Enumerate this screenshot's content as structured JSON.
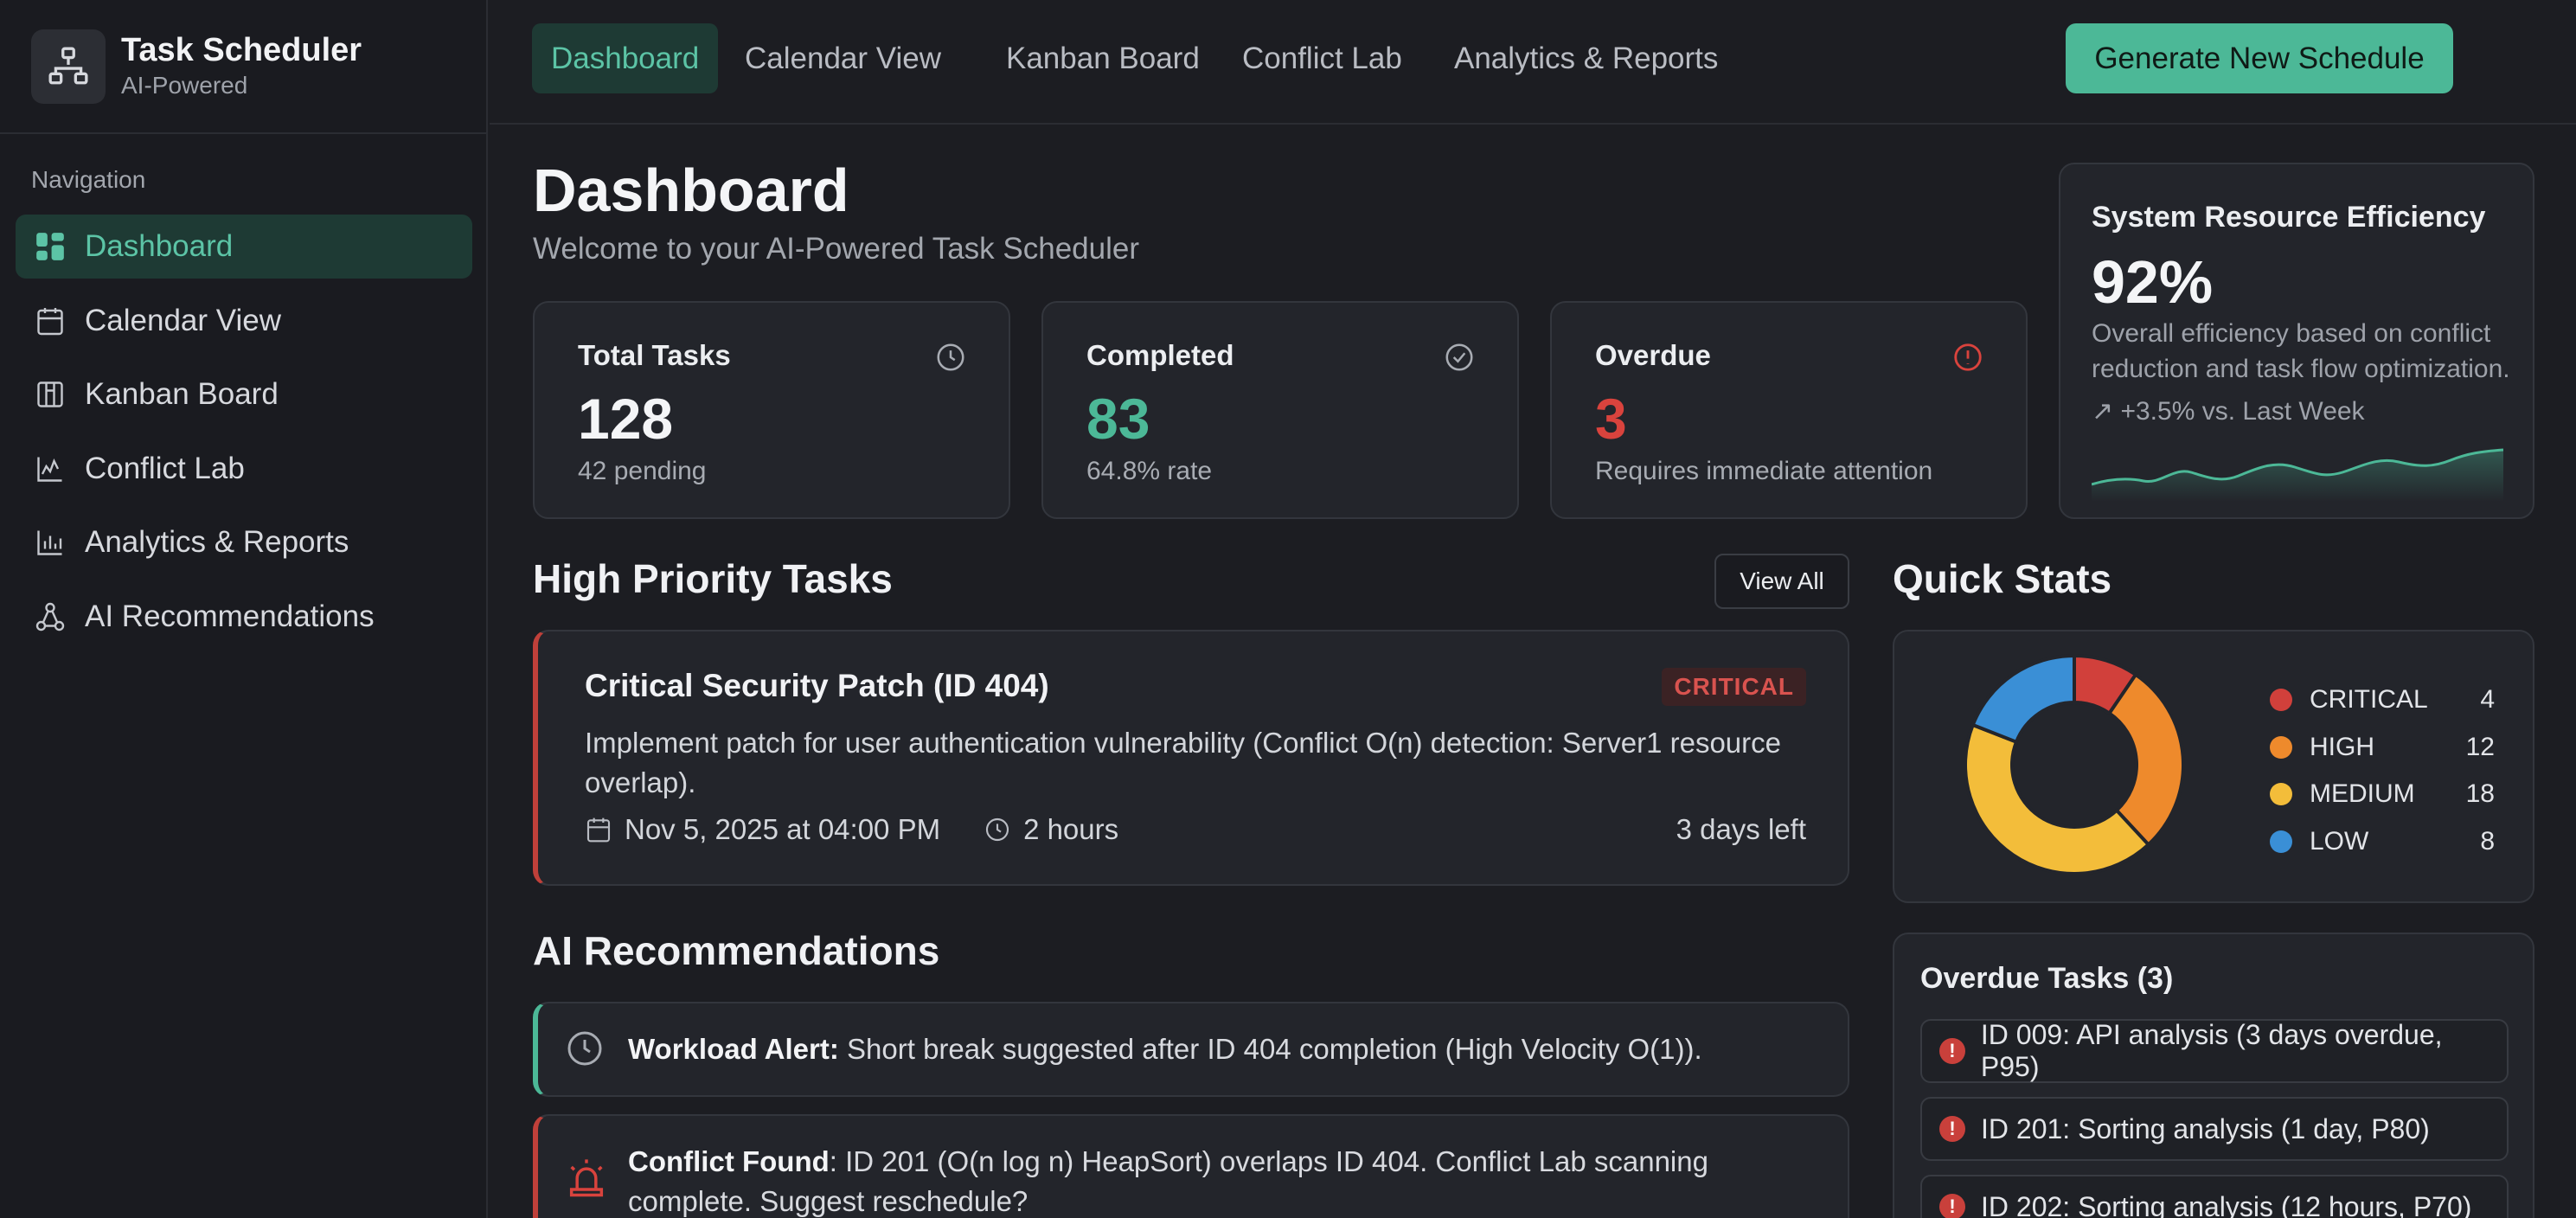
{
  "app": {
    "title": "Task Scheduler",
    "subtitle": "AI-Powered"
  },
  "sidebar": {
    "heading": "Navigation",
    "items": [
      {
        "label": "Dashboard",
        "icon": "dashboard-icon",
        "active": true
      },
      {
        "label": "Calendar View",
        "icon": "calendar-icon"
      },
      {
        "label": "Kanban Board",
        "icon": "kanban-icon"
      },
      {
        "label": "Conflict Lab",
        "icon": "conflict-lab-icon"
      },
      {
        "label": "Analytics & Reports",
        "icon": "analytics-icon"
      },
      {
        "label": "AI Recommendations",
        "icon": "ai-network-icon"
      }
    ]
  },
  "topbar": {
    "tabs": [
      "Dashboard",
      "Calendar View",
      "Kanban Board",
      "Conflict Lab",
      "Analytics & Reports"
    ],
    "active_tab": "Dashboard",
    "generate_label": "Generate New Schedule"
  },
  "page": {
    "title": "Dashboard",
    "subtitle": "Welcome to your AI-Powered Task Scheduler"
  },
  "stats": [
    {
      "label": "Total Tasks",
      "value": "128",
      "note": "42 pending",
      "icon": "clock-icon",
      "color": "#f4f5f7"
    },
    {
      "label": "Completed",
      "value": "83",
      "note": "64.8% rate",
      "icon": "check-circle-icon",
      "color": "#4cb897"
    },
    {
      "label": "Overdue",
      "value": "3",
      "note": "Requires immediate attention",
      "icon": "alert-circle-icon",
      "color": "#d9433d"
    }
  ],
  "efficiency": {
    "title": "System Resource Efficiency",
    "value": "92%",
    "description": "Overall efficiency based on conflict reduction and task flow optimization.",
    "trend": "↗ +3.5% vs. Last Week"
  },
  "high_priority": {
    "title": "High Priority Tasks",
    "view_all": "View All",
    "task": {
      "title": "Critical Security Patch (ID 404)",
      "badge": "CRITICAL",
      "description": "Implement patch for user authentication vulnerability (Conflict O(n) detection: Server1 resource overlap).",
      "date": "Nov 5, 2025 at 04:00 PM",
      "duration": "2 hours",
      "remaining": "3 days left"
    }
  },
  "recommendations": {
    "title": "AI Recommendations",
    "items": [
      {
        "bold": "Workload Alert:",
        "text": " Short break suggested after ID 404 completion (High Velocity O(1)).",
        "icon": "clock-icon"
      },
      {
        "bold": "Conflict Found",
        "text": ": ID 201 (O(n log n) HeapSort) overlaps ID 404. Conflict Lab scanning complete. Suggest reschedule?",
        "icon": "siren-icon"
      }
    ]
  },
  "quick_stats": {
    "title": "Quick Stats",
    "legend": [
      {
        "name": "CRITICAL",
        "count": "4",
        "color": "#d1403b"
      },
      {
        "name": "HIGH",
        "count": "12",
        "color": "#ee8a2c"
      },
      {
        "name": "MEDIUM",
        "count": "18",
        "color": "#f3bd3a"
      },
      {
        "name": "LOW",
        "count": "8",
        "color": "#3a8fd6"
      }
    ]
  },
  "chart_data": {
    "type": "pie",
    "categories": [
      "CRITICAL",
      "HIGH",
      "MEDIUM",
      "LOW"
    ],
    "values": [
      4,
      12,
      18,
      8
    ]
  },
  "overdue": {
    "title": "Overdue Tasks (3)",
    "items": [
      "ID 009: API analysis (3 days overdue, P95)",
      "ID 201: Sorting analysis (1 day, P80)",
      "ID 202: Sorting analysis (12 hours, P70)"
    ]
  }
}
